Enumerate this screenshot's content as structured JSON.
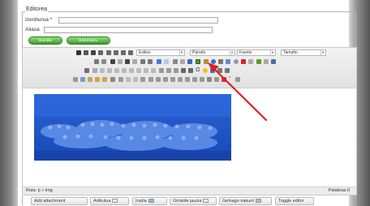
{
  "form": {
    "legend": "Editorea",
    "name_label": "Izenburua *",
    "alias_label": "Aliasa",
    "name_value": "",
    "alias_value": "",
    "save_button": "Gorde",
    "close_button": "Ezeztatu"
  },
  "toolbar": {
    "styles_select": "Estilos",
    "paragraph_select": "Párrafo",
    "font_select": "Fuente",
    "size_select": "Tamaño",
    "omega_icon": "Ω",
    "quote_icon": "“"
  },
  "status_bar": {
    "path": "Ruta: p » img",
    "word_count": "Palabras:0"
  },
  "buttons": {
    "add_attachment": "Add attachment",
    "article": "Artikulua",
    "image": "Irudia",
    "page_break": "Orrialde jauzia",
    "read_more": "Gehiago irakurri",
    "toggle_editor": "Toggle editor"
  },
  "colors": {
    "save_green": "#4aa934",
    "image_blue": "#1c56c8",
    "arrow_red": "#e02020"
  }
}
